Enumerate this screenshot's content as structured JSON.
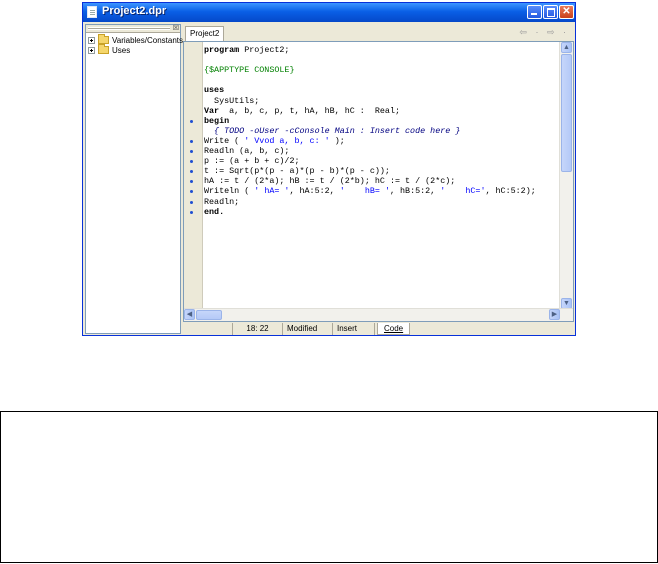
{
  "window": {
    "title": "Project2.dpr",
    "icon": "document-icon"
  },
  "tree": {
    "items": [
      {
        "label": "Variables/Constants",
        "icon": "folder-icon"
      },
      {
        "label": "Uses",
        "icon": "folder-icon"
      }
    ]
  },
  "editor": {
    "tab_label": "Project2",
    "nav_arrows": "⇦ · ⇨ ·",
    "lines": [
      {
        "segments": [
          {
            "t": "program",
            "c": "kw"
          },
          {
            "t": " Project2;",
            "c": ""
          }
        ],
        "dot": false
      },
      {
        "segments": [
          {
            "t": "",
            "c": ""
          }
        ],
        "dot": false
      },
      {
        "segments": [
          {
            "t": "{$APPTYPE CONSOLE}",
            "c": "dir"
          }
        ],
        "dot": false
      },
      {
        "segments": [
          {
            "t": "",
            "c": ""
          }
        ],
        "dot": false
      },
      {
        "segments": [
          {
            "t": "uses",
            "c": "kw"
          }
        ],
        "dot": false
      },
      {
        "segments": [
          {
            "t": "  SysUtils;",
            "c": ""
          }
        ],
        "dot": false
      },
      {
        "segments": [
          {
            "t": "Var",
            "c": "kw"
          },
          {
            "t": "  a, b, c, p, t, hA, hB, hC :  Real;",
            "c": ""
          }
        ],
        "dot": false
      },
      {
        "segments": [
          {
            "t": "begin",
            "c": "kw"
          }
        ],
        "dot": true
      },
      {
        "segments": [
          {
            "t": "  { TODO -oUser -cConsole Main : Insert code here }",
            "c": "com"
          }
        ],
        "dot": false
      },
      {
        "segments": [
          {
            "t": "Write ( ",
            "c": ""
          },
          {
            "t": "' Vvod a, b, c: '",
            "c": "str"
          },
          {
            "t": " );",
            "c": ""
          }
        ],
        "dot": true
      },
      {
        "segments": [
          {
            "t": "Readln (a, b, c);",
            "c": ""
          }
        ],
        "dot": true
      },
      {
        "segments": [
          {
            "t": "p := (a + b + c)/2;",
            "c": ""
          }
        ],
        "dot": true
      },
      {
        "segments": [
          {
            "t": "t := Sqrt(p*(p - a)*(p - b)*(p - c));",
            "c": ""
          }
        ],
        "dot": true
      },
      {
        "segments": [
          {
            "t": "hA := t / (2*a); hB := t / (2*b); hC := t / (2*c);",
            "c": ""
          }
        ],
        "dot": true
      },
      {
        "segments": [
          {
            "t": "Writeln ( ",
            "c": ""
          },
          {
            "t": "' hA= '",
            "c": "str"
          },
          {
            "t": ", hA:5:2, ",
            "c": ""
          },
          {
            "t": "'    hB= '",
            "c": "str"
          },
          {
            "t": ", hB:5:2, ",
            "c": ""
          },
          {
            "t": "'    hC='",
            "c": "str"
          },
          {
            "t": ", hC:5:2);",
            "c": ""
          }
        ],
        "dot": true
      },
      {
        "segments": [
          {
            "t": "Readln;",
            "c": ""
          }
        ],
        "dot": true
      },
      {
        "segments": [
          {
            "t": "end.",
            "c": "kw"
          }
        ],
        "dot": true
      }
    ]
  },
  "status": {
    "position": "18: 22",
    "modified": "Modified",
    "mode": "Insert",
    "view_tab": "Code"
  }
}
